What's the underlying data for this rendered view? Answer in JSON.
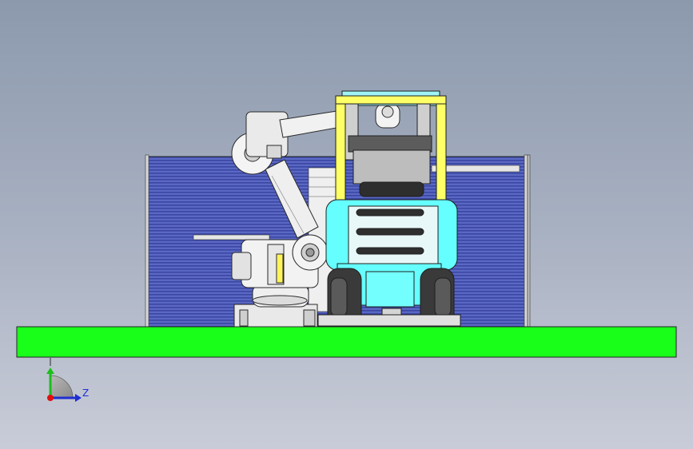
{
  "viewport": {
    "background_top": "#8c99ad",
    "background_bottom": "#c9ccd8"
  },
  "triad": {
    "axis_label_z": "Z",
    "colors": {
      "y_axis": "#1bbf1b",
      "z_axis": "#1f2fd0",
      "origin": "#e01010"
    }
  },
  "model": {
    "floor_color": "#19ff19",
    "fence_panel_color": "#4d5bb8",
    "forklift_body_color": "#66ffff",
    "forklift_mast_color": "#ffff66",
    "robot_color": "#ececec",
    "tire_color": "#3a3a3a"
  }
}
